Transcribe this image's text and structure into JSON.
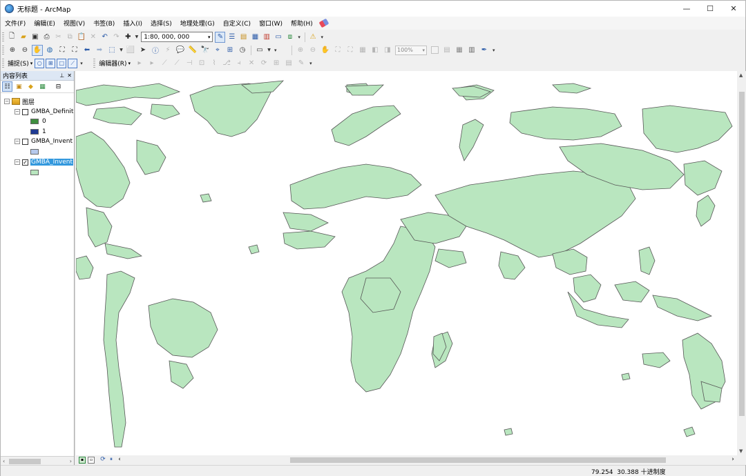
{
  "window": {
    "title": "无标题 - ArcMap",
    "controls": [
      "—",
      "☐",
      "✕"
    ]
  },
  "menu": [
    "文件(F)",
    "编辑(E)",
    "视图(V)",
    "书签(B)",
    "插入(I)",
    "选择(S)",
    "地理处理(G)",
    "自定义(C)",
    "窗口(W)",
    "帮助(H)"
  ],
  "toolbar": {
    "scale": "1:80, 000, 000",
    "zoom_level": "100%",
    "snapping_label": "捕捉(S)",
    "editor_label": "编辑器(R)"
  },
  "toc": {
    "title": "内容列表",
    "root_label": "图层",
    "layers": [
      {
        "name": "GMBA_Definit",
        "checked": false,
        "expanded": true,
        "legend": [
          {
            "label": "0",
            "color": "#3f8e3f"
          },
          {
            "label": "1",
            "color": "#1f3a93"
          }
        ]
      },
      {
        "name": "GMBA_Invent",
        "checked": false,
        "expanded": true,
        "legend": [
          {
            "label": "",
            "color": "#b6c9ec"
          }
        ]
      },
      {
        "name": "GMBA_Invent",
        "checked": true,
        "expanded": true,
        "selected": true,
        "legend": [
          {
            "label": "",
            "color": "#b9e6bf"
          }
        ]
      }
    ]
  },
  "status": {
    "x": "79.254",
    "y": "30.388",
    "units": "十进制度"
  },
  "colors": {
    "land_fill": "#b9e6bf",
    "land_stroke": "#555555",
    "selection": "#3398dd"
  }
}
